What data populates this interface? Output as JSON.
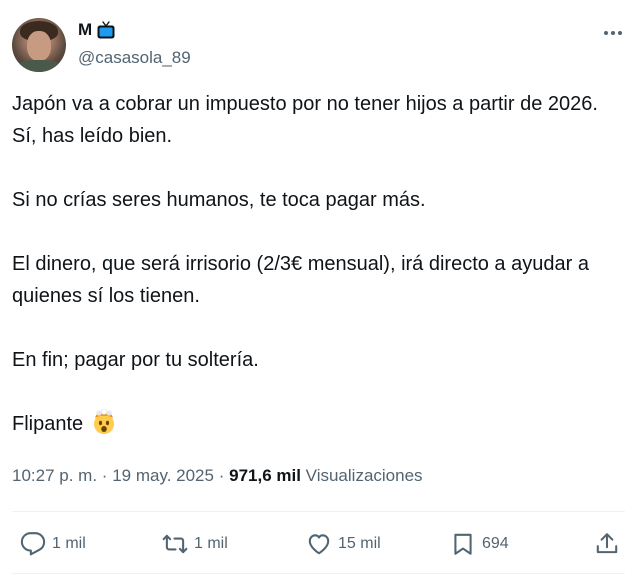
{
  "user": {
    "display_name": "M",
    "name_emoji_icon": "tv-icon",
    "handle": "@casasola_89",
    "avatar": "profile-photo"
  },
  "tweet": {
    "paragraphs": [
      "Japón va a cobrar un impuesto por no tener hijos a partir de 2026. Sí, has leído bien.",
      "Si no crías seres humanos, te toca pagar más.",
      "El dinero, que será irrisorio (2/3€ mensual), irá directo a ayudar a quienes sí los tienen.",
      "En fin; pagar por tu soltería.",
      "Flipante"
    ],
    "final_emoji": "exploding-head-icon"
  },
  "meta": {
    "time": "10:27 p. m.",
    "separator": "·",
    "date": "19 may. 2025",
    "views_count": "971,6 mil",
    "views_label": "Visualizaciones"
  },
  "actions": {
    "replies": "1 mil",
    "reposts": "1 mil",
    "likes": "15 mil",
    "bookmarks": "694"
  },
  "colors": {
    "text": "#0f1419",
    "secondary": "#536471",
    "divider": "#eff3f4",
    "tv_blue": "#1d9bf0"
  }
}
